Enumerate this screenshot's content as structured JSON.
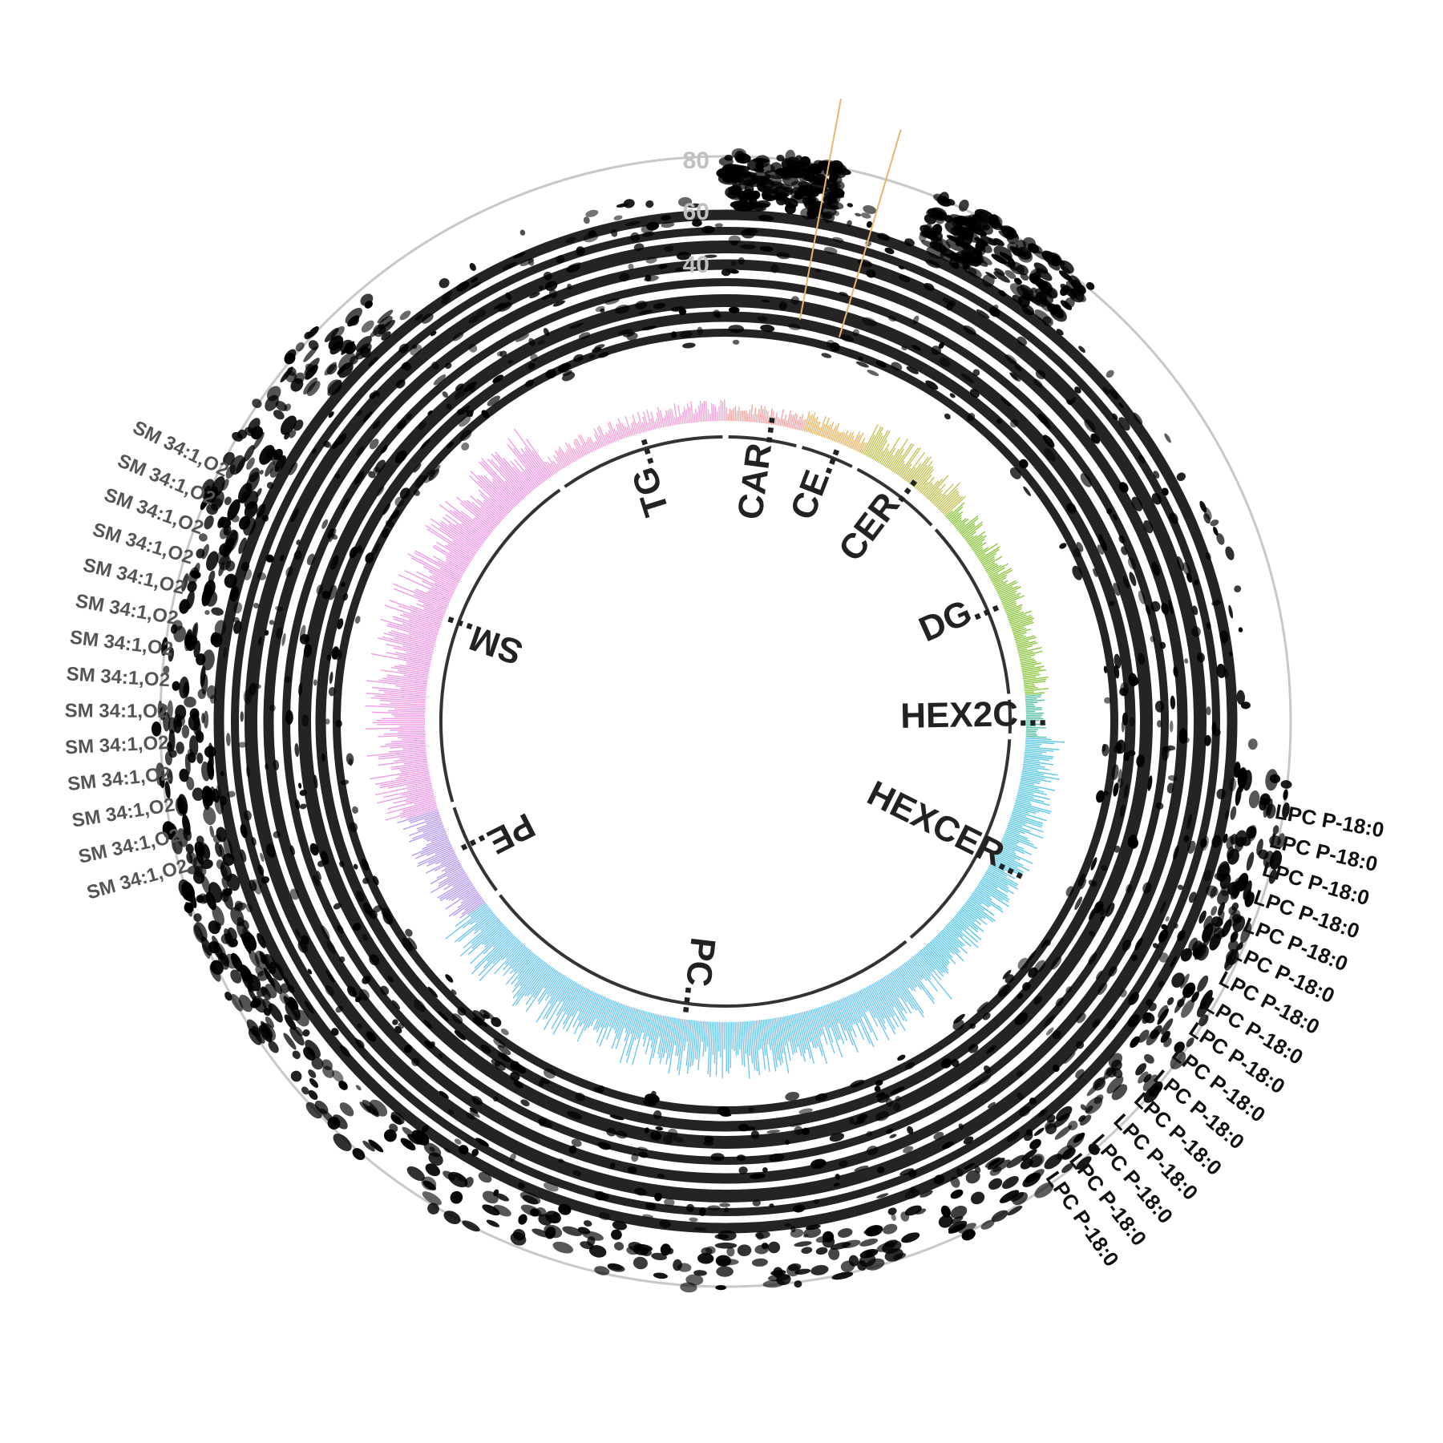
{
  "chart_data": {
    "type": "bar",
    "layout": "circular",
    "title": "",
    "xlabel": "",
    "ylabel": "",
    "ylim": [
      0,
      80
    ],
    "radial_ticks": [
      "40",
      "60",
      "80"
    ],
    "grid": false,
    "categories": [
      "CAR...",
      "CE...",
      "CER...",
      "DG...",
      "HEX2C...",
      "HEXCER...",
      "PC...",
      "PE...",
      "SM...",
      "TG..."
    ],
    "category_spans": [
      {
        "name": "CAR...",
        "start_deg": 0,
        "end_deg": 15,
        "color": "#f4a6a6",
        "bar_height": 0.25
      },
      {
        "name": "CE...",
        "start_deg": 15,
        "end_deg": 27,
        "color": "#e8b86a",
        "bar_height": 0.3
      },
      {
        "name": "CER...",
        "start_deg": 27,
        "end_deg": 47,
        "color": "#c4c35a",
        "bar_height": 0.5
      },
      {
        "name": "DG...",
        "start_deg": 47,
        "end_deg": 85,
        "color": "#8cc63f",
        "bar_height": 0.35
      },
      {
        "name": "HEX2C...",
        "start_deg": 85,
        "end_deg": 93,
        "color": "#55c0a8",
        "bar_height": 0.3
      },
      {
        "name": "HEXCER...",
        "start_deg": 93,
        "end_deg": 140,
        "color": "#5ac8e8",
        "bar_height": 0.55
      },
      {
        "name": "PC...",
        "start_deg": 140,
        "end_deg": 233,
        "color": "#6fc6f2",
        "bar_height": 0.8
      },
      {
        "name": "PE...",
        "start_deg": 233,
        "end_deg": 253,
        "color": "#b69cf0",
        "bar_height": 0.6
      },
      {
        "name": "SM...",
        "start_deg": 253,
        "end_deg": 325,
        "color": "#f09ce6",
        "bar_height": 0.85
      },
      {
        "name": "TG...",
        "start_deg": 325,
        "end_deg": 360,
        "color": "#f4a6d6",
        "bar_height": 0.3
      }
    ],
    "series": [
      {
        "values": []
      }
    ],
    "annotation_labels": {
      "sm_labels": [
        "SM 34:1,O2",
        "SM 34:1,O2",
        "SM 34:1,O2",
        "SM 34:1,O2",
        "SM 34:1,O2",
        "SM 34:1,O2",
        "SM 34:1,O2",
        "SM 34:1,O2",
        "SM 34:1,O2",
        "SM 34:1,O2",
        "SM 34:1,O2",
        "SM 34:1,O2",
        "SM 34:1,O2",
        "SM 34:1,O2"
      ],
      "lpc_labels": [
        "LPC P-18:0",
        "LPC P-18:0",
        "LPC P-18:0",
        "LPC P-18:0",
        "LPC P-18:0",
        "LPC P-18:0",
        "LPC P-18:0",
        "LPC P-18:0",
        "LPC P-18:0",
        "LPC P-18:0",
        "LPC P-18:0",
        "LPC P-18:0",
        "LPC P-18:0",
        "LPC P-18:0",
        "LPC P-18:0",
        "LPC P-18:0"
      ]
    }
  },
  "colors": {
    "axis_ring": "#c8c8c8",
    "track_ring": "#111111",
    "inner_ring": "#333333",
    "highlight_line": "#e8b86a"
  }
}
